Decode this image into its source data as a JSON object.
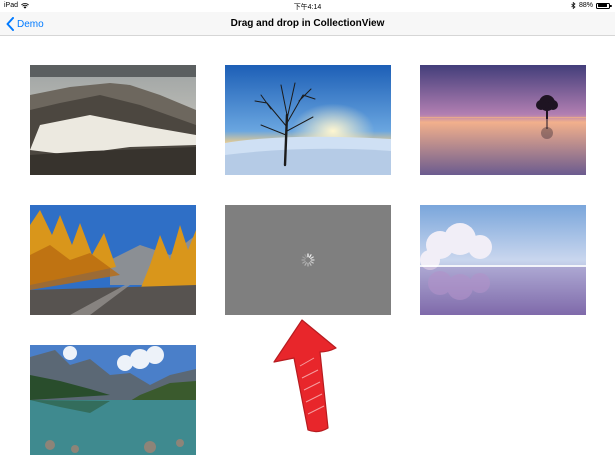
{
  "status_bar": {
    "device": "iPad",
    "time": "下午4:14",
    "battery": "88%",
    "battery_level": 0.88,
    "icons": [
      "wifi-icon",
      "bluetooth-icon",
      "battery-icon"
    ]
  },
  "nav": {
    "back_label": "Demo",
    "title": "Drag and drop in CollectionView"
  },
  "colors": {
    "accent": "#007aff",
    "loading_tile": "#7f7f7f",
    "annotation_arrow": "#e8262b"
  },
  "grid": {
    "items": [
      {
        "name": "mountain-clouds-photo",
        "state": "loaded"
      },
      {
        "name": "snowy-tree-sunset-photo",
        "state": "loaded"
      },
      {
        "name": "lake-tree-dusk-photo",
        "state": "loaded"
      },
      {
        "name": "autumn-forest-road-photo",
        "state": "loaded"
      },
      {
        "name": "loading-placeholder",
        "state": "loading"
      },
      {
        "name": "frosted-trees-lake-photo",
        "state": "loaded"
      },
      {
        "name": "mountain-lake-reflection-photo",
        "state": "loaded"
      }
    ]
  },
  "annotation": {
    "icon": "red-arrow-icon"
  }
}
